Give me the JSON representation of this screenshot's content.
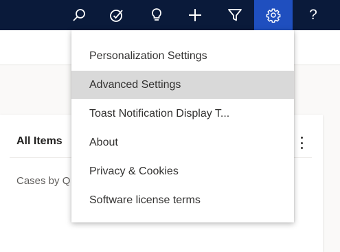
{
  "topbar": {
    "icons": [
      "search-icon",
      "task-check-icon",
      "lightbulb-icon",
      "plus-icon",
      "filter-icon",
      "gear-icon",
      "help-icon"
    ],
    "help_label": "?",
    "colors": {
      "background": "#0a1a3a",
      "active": "#1f4fbf"
    }
  },
  "settings_menu": {
    "items": [
      {
        "label": "Personalization Settings"
      },
      {
        "label": "Advanced Settings",
        "highlighted": true
      },
      {
        "label": "Toast Notification Display T..."
      },
      {
        "label": "About"
      },
      {
        "label": "Privacy & Cookies"
      },
      {
        "label": "Software license terms"
      }
    ]
  },
  "card": {
    "title": "All Items",
    "subtitle": "Cases by Q",
    "more_icon": "more-vertical-icon"
  }
}
